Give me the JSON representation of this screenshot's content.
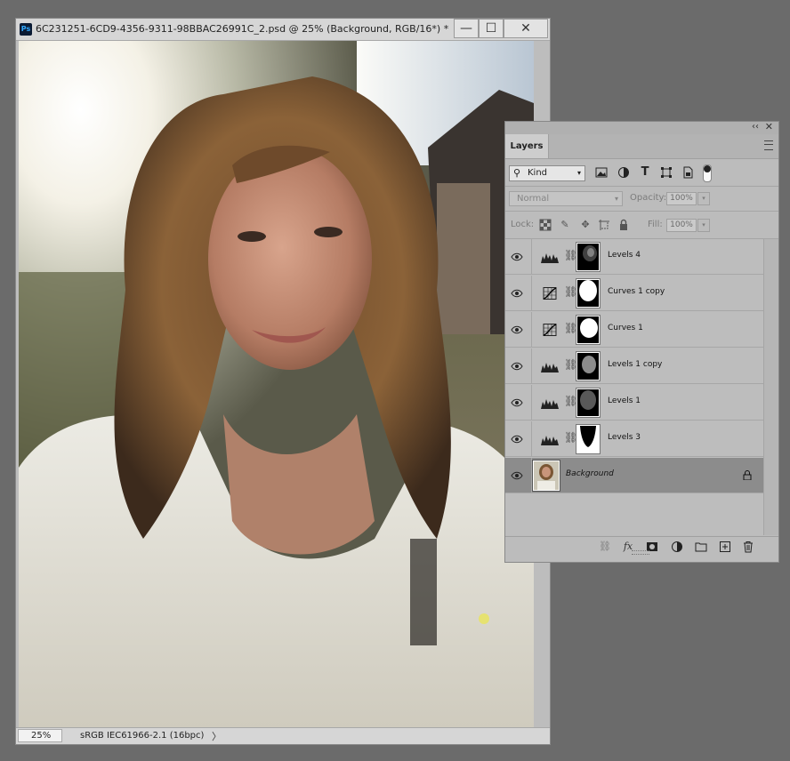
{
  "document": {
    "app_icon": "Ps",
    "title": "6C231251-6CD9-4356-9311-98BBAC26991C_2.psd @ 25% (Background, RGB/16*) *",
    "window_controls": {
      "minimize": "—",
      "maximize": "☐",
      "close": "✕"
    },
    "status": {
      "zoom": "25%",
      "profile": "sRGB IEC61966-2.1 (16bpc)",
      "arrow": "〉"
    }
  },
  "layers_panel": {
    "tab_label": "Layers",
    "collapse_label": "‹‹",
    "close_label": "✕",
    "filter_kind": "Kind",
    "blend_mode": "Normal",
    "opacity_label": "Opacity:",
    "opacity_value": "100%",
    "lock_label": "Lock:",
    "fill_label": "Fill:",
    "fill_value": "100%",
    "layers": [
      {
        "name": "Levels 4",
        "type": "levels",
        "visible": true,
        "selected": false,
        "mask": "levels4"
      },
      {
        "name": "Curves 1 copy",
        "type": "curves",
        "visible": true,
        "selected": false,
        "mask": "curves1copy"
      },
      {
        "name": "Curves 1",
        "type": "curves",
        "visible": true,
        "selected": false,
        "mask": "curves1"
      },
      {
        "name": "Levels 1 copy",
        "type": "levels",
        "visible": true,
        "selected": false,
        "mask": "levels1copy"
      },
      {
        "name": "Levels 1",
        "type": "levels",
        "visible": true,
        "selected": false,
        "mask": "levels1"
      },
      {
        "name": "Levels 3",
        "type": "levels",
        "visible": true,
        "selected": false,
        "mask": "levels3"
      },
      {
        "name": "Background",
        "type": "pixel",
        "visible": true,
        "selected": true,
        "locked": true
      }
    ],
    "footer_icons": [
      "link-layers-icon",
      "fx-icon",
      "add-mask-icon",
      "adjustment-layer-icon",
      "group-folder-icon",
      "new-layer-icon",
      "trash-icon"
    ]
  }
}
